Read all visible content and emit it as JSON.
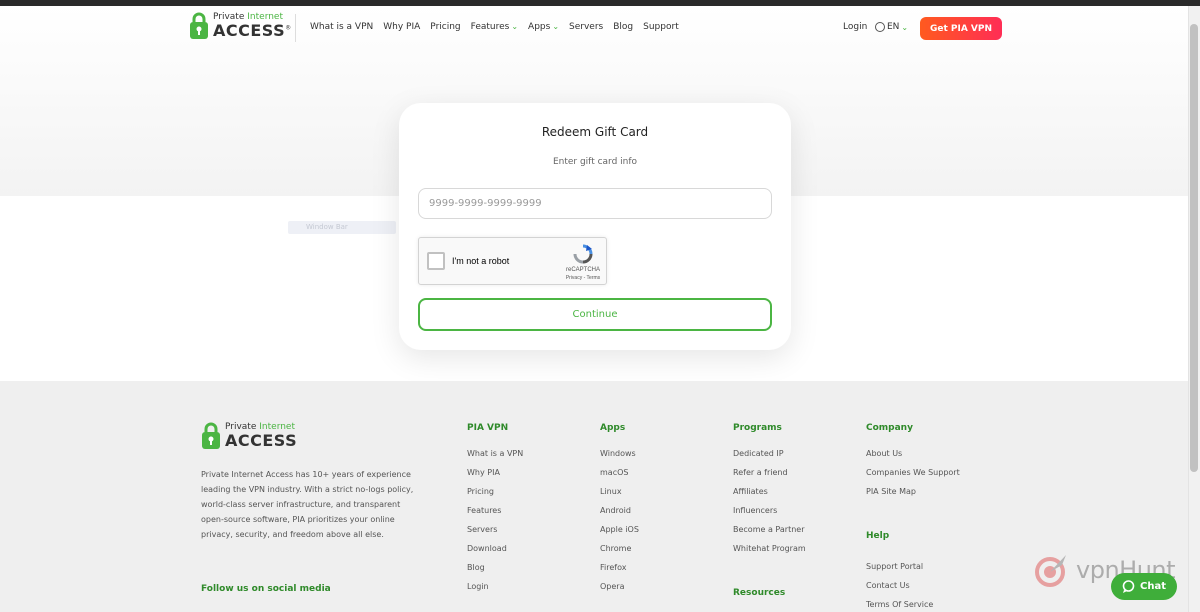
{
  "header": {
    "logo_small_1": "Private",
    "logo_small_2": "Internet",
    "logo_big": "ACCESS",
    "logo_mark": "®",
    "nav": [
      "What is a VPN",
      "Why PIA",
      "Pricing",
      "Features",
      "Apps",
      "Servers",
      "Blog",
      "Support"
    ],
    "login": "Login",
    "lang": "EN",
    "cta": "Get PIA VPN"
  },
  "stray_label": "Window Bar",
  "card": {
    "title": "Redeem Gift Card",
    "subtitle": "Enter gift card info",
    "input_placeholder": "9999-9999-9999-9999",
    "input_value": "",
    "recaptcha_label": "I'm not a robot",
    "recaptcha_brand": "reCAPTCHA",
    "recaptcha_terms": "Privacy - Terms",
    "continue": "Continue"
  },
  "footer": {
    "description": "Private Internet Access has 10+ years of experience leading the VPN industry. With a strict no-logs policy, world-class server infrastructure, and transparent open-source software, PIA prioritizes your online privacy, security, and freedom above all else.",
    "follow": "Follow us on social media",
    "columns": [
      {
        "heading": "PIA VPN",
        "links": [
          "What is a VPN",
          "Why PIA",
          "Pricing",
          "Features",
          "Servers",
          "Download",
          "Blog",
          "Login"
        ]
      },
      {
        "heading": "Apps",
        "links": [
          "Windows",
          "macOS",
          "Linux",
          "Android",
          "Apple iOS",
          "Chrome",
          "Firefox",
          "Opera"
        ]
      },
      {
        "heading": "Programs",
        "links": [
          "Dedicated IP",
          "Refer a friend",
          "Affiliates",
          "Influencers",
          "Become a Partner",
          "Whitehat Program"
        ]
      },
      {
        "heading": "Company",
        "links": [
          "About Us",
          "Companies We Support",
          "PIA Site Map"
        ]
      }
    ],
    "resources_heading": "Resources",
    "help_heading": "Help",
    "help_links": [
      "Support Portal",
      "Contact Us",
      "Terms Of Service"
    ]
  },
  "watermark": "vpnHunt",
  "chat": "Chat",
  "colors": {
    "brand_green": "#4bb543",
    "cta_start": "#ff5a1f",
    "cta_end": "#ff2d55"
  }
}
